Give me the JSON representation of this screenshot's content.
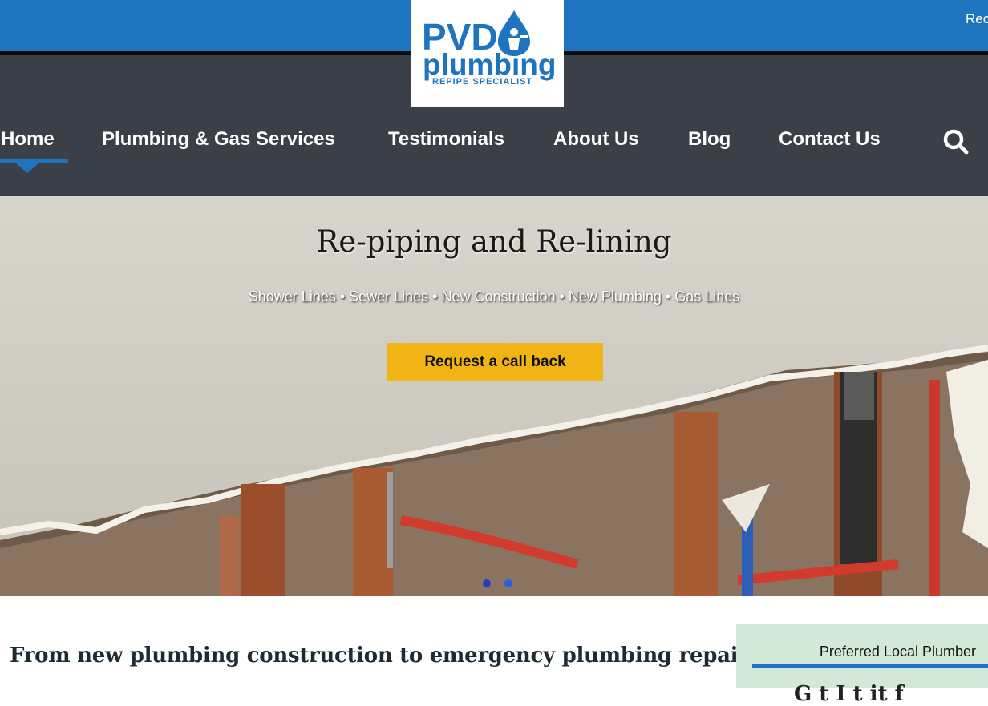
{
  "topbar": {
    "right_text": "Rec"
  },
  "logo": {
    "line1": "PVD",
    "line2": "plumbing",
    "line3": "REPIPE SPECIALIST"
  },
  "nav": {
    "items": [
      {
        "label": "Home",
        "active": true
      },
      {
        "label": "Plumbing & Gas Services"
      },
      {
        "label": "Testimonials"
      },
      {
        "label": "About Us"
      },
      {
        "label": "Blog"
      },
      {
        "label": "Contact Us"
      }
    ],
    "search_icon": "search-icon"
  },
  "hero": {
    "title": "Re-piping and Re-lining",
    "subtitle": "Shower Lines • Sewer Lines • New Construction • New Plumbing • Gas Lines",
    "cta_label": "Request a call back",
    "slides": 2,
    "active_slide": 2
  },
  "content": {
    "headline": "From new plumbing construction to emergency plumbing repairs."
  },
  "sidebar": {
    "label": "Preferred Local Plumber",
    "partial_heading": "G   t I t    it  f"
  },
  "colors": {
    "brand_blue": "#1f74c0",
    "nav_bg": "#3a3f48",
    "cta_yellow": "#f0b414",
    "panel_green": "#d4e8da"
  }
}
